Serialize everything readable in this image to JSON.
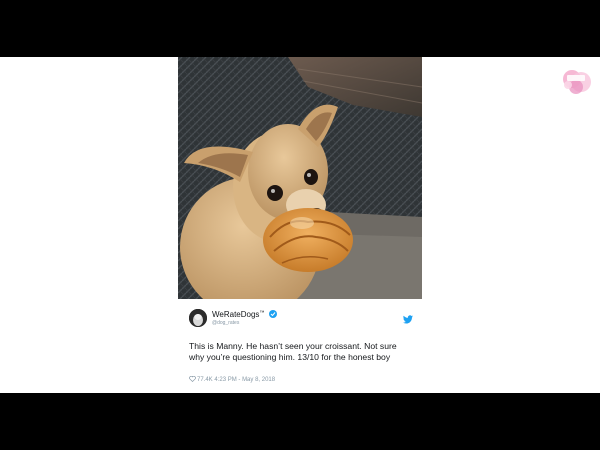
{
  "tweet": {
    "display_name": "WeRateDogs",
    "trademark": "™",
    "handle": "@dog_rates",
    "text": "This is Manny. He hasn’t seen your croissant. Not sure why you’re questioning him. 13/10 for the honest boy",
    "likes": "77.4K",
    "time": "4:23 PM",
    "date": "May 8, 2018",
    "verified_icon": "verified-badge",
    "service_icon": "twitter-bird"
  },
  "colors": {
    "accent": "#1da1f2",
    "text": "#14171a",
    "muted": "#8899a6"
  }
}
